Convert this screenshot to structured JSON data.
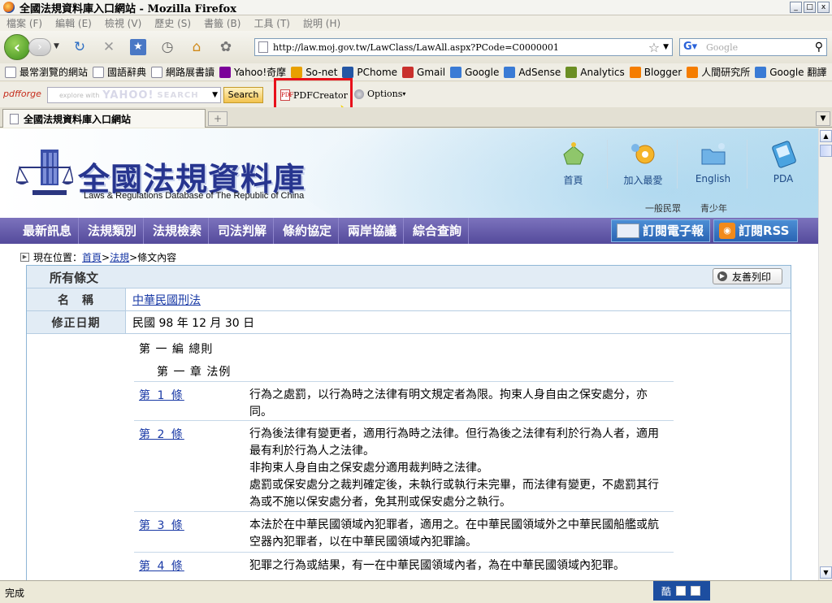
{
  "window": {
    "title": "全國法規資料庫入口網站 - Mozilla Firefox",
    "min": "_",
    "max": "□",
    "close": "x"
  },
  "menu": [
    "檔案 (F)",
    "編輯 (E)",
    "檢視 (V)",
    "歷史 (S)",
    "書籤 (B)",
    "工具 (T)",
    "說明 (H)"
  ],
  "nav": {
    "url": "http://law.moj.gov.tw/LawClass/LawAll.aspx?PCode=C0000001",
    "search_placeholder": "Google"
  },
  "bookmarks": [
    {
      "label": "最常瀏覽的網站",
      "icon": "page-icon",
      "color": "#ffffff"
    },
    {
      "label": "國語辭典",
      "icon": "page-icon",
      "color": "#ffffff"
    },
    {
      "label": "網路展書讀",
      "icon": "page-icon",
      "color": "#ffffff"
    },
    {
      "label": "Yahoo!奇摩",
      "icon": "yahoo-icon",
      "color": "#7b0099"
    },
    {
      "label": "So-net",
      "icon": "sonet-icon",
      "color": "#e8a000"
    },
    {
      "label": "PChome",
      "icon": "pchome-icon",
      "color": "#2456a4"
    },
    {
      "label": "Gmail",
      "icon": "gmail-icon",
      "color": "#c9302c"
    },
    {
      "label": "Google",
      "icon": "google-icon",
      "color": "#3a7bd5"
    },
    {
      "label": "AdSense",
      "icon": "google-icon",
      "color": "#3a7bd5"
    },
    {
      "label": "Analytics",
      "icon": "analytics-icon",
      "color": "#6b8e23"
    },
    {
      "label": "Blogger",
      "icon": "blogger-icon",
      "color": "#f57d00"
    },
    {
      "label": "人間研究所",
      "icon": "blogger-icon",
      "color": "#f57d00"
    },
    {
      "label": "Google 翻譯",
      "icon": "google-icon",
      "color": "#3a7bd5"
    }
  ],
  "bookmarks_more": "»",
  "pdfforge": {
    "logo": "pdfforge",
    "search_hint": "explore with",
    "yahoo": "YAHOO!",
    "yahoo_search": "SEARCH",
    "search_button": "Search",
    "pdfcreator": "PDFCreator",
    "options": "Options"
  },
  "tab": {
    "title": "全國法規資料庫入口網站",
    "new_tab": "+"
  },
  "site": {
    "title": "全國法規資料庫",
    "subtitle": "Laws & Regulations Database of The Republic of China",
    "topnav": [
      "首頁",
      "加入最愛",
      "English",
      "PDA"
    ],
    "audience": [
      "一般民眾",
      "青少年"
    ],
    "mainnav": [
      "最新訊息",
      "法規類別",
      "法規檢索",
      "司法判解",
      "條約協定",
      "兩岸協議",
      "綜合查詢"
    ],
    "subscribe_epaper": "訂閱電子報",
    "subscribe_rss": "訂閱RSS",
    "breadcrumb": {
      "prefix": "現在位置：",
      "home": "首頁",
      "sep1": " > ",
      "laws": "法規",
      "sep2": " > ",
      "current": "條文內容"
    }
  },
  "panel": {
    "title": "所有條文",
    "print": "友善列印",
    "name_label": "名　稱",
    "name_value": "中華民國刑法",
    "date_label": "修正日期",
    "date_value": "民國 98 年 12 月 30 日",
    "part": "第 一 編 總則",
    "chapter": "第 一 章 法例",
    "articles": [
      {
        "no": "第 1 條",
        "text": "行為之處罰，以行為時之法律有明文規定者為限。拘束人身自由之保安處分，亦同。"
      },
      {
        "no": "第 2 條",
        "text": "行為後法律有變更者，適用行為時之法律。但行為後之法律有利於行為人者，適用最有利於行為人之法律。\n非拘束人身自由之保安處分適用裁判時之法律。\n處罰或保安處分之裁判確定後，未執行或執行未完畢，而法律有變更，不處罰其行為或不施以保安處分者，免其刑或保安處分之執行。"
      },
      {
        "no": "第 3 條",
        "text": "本法於在中華民國領域內犯罪者，適用之。在中華民國領域外之中華民國船艦或航空器內犯罪者，以在中華民國領域內犯罪論。"
      },
      {
        "no": "第 4 條",
        "text": "犯罪之行為或結果，有一在中華民國領域內者，為在中華民國領域內犯罪。"
      }
    ]
  },
  "status": {
    "text": "完成",
    "ime": "酷"
  }
}
